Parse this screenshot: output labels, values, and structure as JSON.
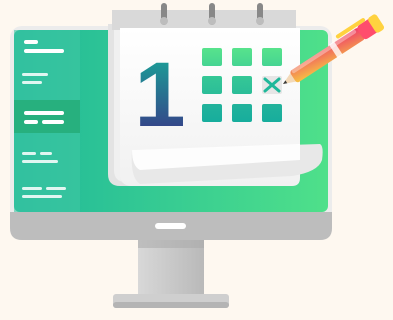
{
  "illustration": {
    "calendar_digit": "1",
    "grid_rows": 3,
    "grid_cols": 3,
    "marked_cell": "row-2-col-3"
  },
  "colors": {
    "background": "#fef8f0",
    "screen_gradient_start": "#1fb89a",
    "screen_gradient_end": "#4fe08a",
    "monitor_frame": "#ececec",
    "monitor_bezel_bottom": "#bdbdbd",
    "stand": "#c8c8c8",
    "sidebar": "#3fc7a4",
    "sidebar_active": "#27b07e",
    "calendar_page": "#ffffff",
    "calendar_shadow": "#dcdcdc",
    "digit_gradient_top": "#16b09a",
    "digit_gradient_bottom": "#3b2f86",
    "grid_cell_top": "#54e090",
    "grid_cell_bottom": "#17ad9d",
    "pen_body_start": "#f6c343",
    "pen_body_end": "#ef3d6b",
    "pen_cap": "#ff4d6d",
    "pen_tip": "#3a3a3a"
  },
  "icons": {
    "mark": "x-mark-icon",
    "pen": "pen-icon",
    "rings": "calendar-ring-icon"
  }
}
